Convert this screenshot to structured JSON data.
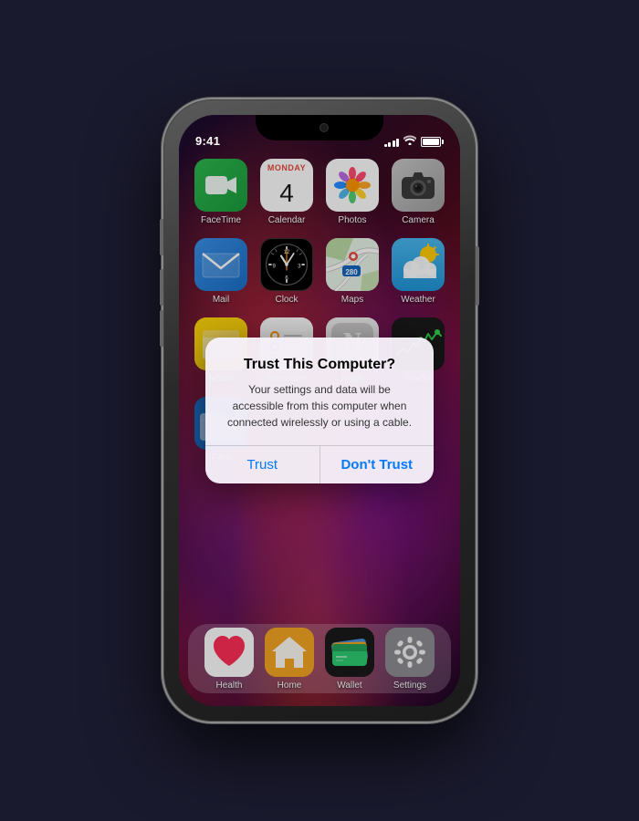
{
  "phone": {
    "status": {
      "time": "9:41",
      "signal_bars": [
        3,
        5,
        7,
        9,
        11
      ],
      "battery_level": "100%"
    },
    "apps": {
      "row1": [
        {
          "id": "facetime",
          "label": "FaceTime",
          "icon_type": "facetime"
        },
        {
          "id": "calendar",
          "label": "Calendar",
          "icon_type": "calendar",
          "calendar_day": "Monday",
          "calendar_num": "4"
        },
        {
          "id": "photos",
          "label": "Photos",
          "icon_type": "photos"
        },
        {
          "id": "camera",
          "label": "Camera",
          "icon_type": "camera"
        }
      ],
      "row2": [
        {
          "id": "mail",
          "label": "Mail",
          "icon_type": "mail"
        },
        {
          "id": "clock",
          "label": "Clock",
          "icon_type": "clock"
        },
        {
          "id": "maps",
          "label": "Maps",
          "icon_type": "maps"
        },
        {
          "id": "weather",
          "label": "Weather",
          "icon_type": "weather"
        }
      ],
      "row3": [
        {
          "id": "notes",
          "label": "Notes",
          "icon_type": "notes"
        },
        {
          "id": "reminders",
          "label": "Reminders",
          "icon_type": "reminders"
        },
        {
          "id": "news",
          "label": "News",
          "icon_type": "news"
        },
        {
          "id": "stocks",
          "label": "Stocks",
          "icon_type": "stocks"
        }
      ],
      "row4": [
        {
          "id": "files",
          "label": "Files",
          "icon_type": "files"
        },
        {
          "id": "placeholder2",
          "label": "",
          "icon_type": "empty"
        },
        {
          "id": "placeholder3",
          "label": "",
          "icon_type": "empty"
        },
        {
          "id": "placeholder4",
          "label": "",
          "icon_type": "empty"
        }
      ]
    },
    "dock_apps": [
      {
        "id": "health",
        "label": "Health",
        "icon_type": "health"
      },
      {
        "id": "home",
        "label": "Home",
        "icon_type": "home"
      },
      {
        "id": "wallet",
        "label": "Wallet",
        "icon_type": "wallet"
      },
      {
        "id": "settings",
        "label": "Settings",
        "icon_type": "settings"
      }
    ],
    "dialog": {
      "title": "Trust This Computer?",
      "message": "Your settings and data will be accessible from this computer when connected wirelessly or using a cable.",
      "btn_trust": "Trust",
      "btn_dont_trust": "Don't Trust"
    }
  }
}
